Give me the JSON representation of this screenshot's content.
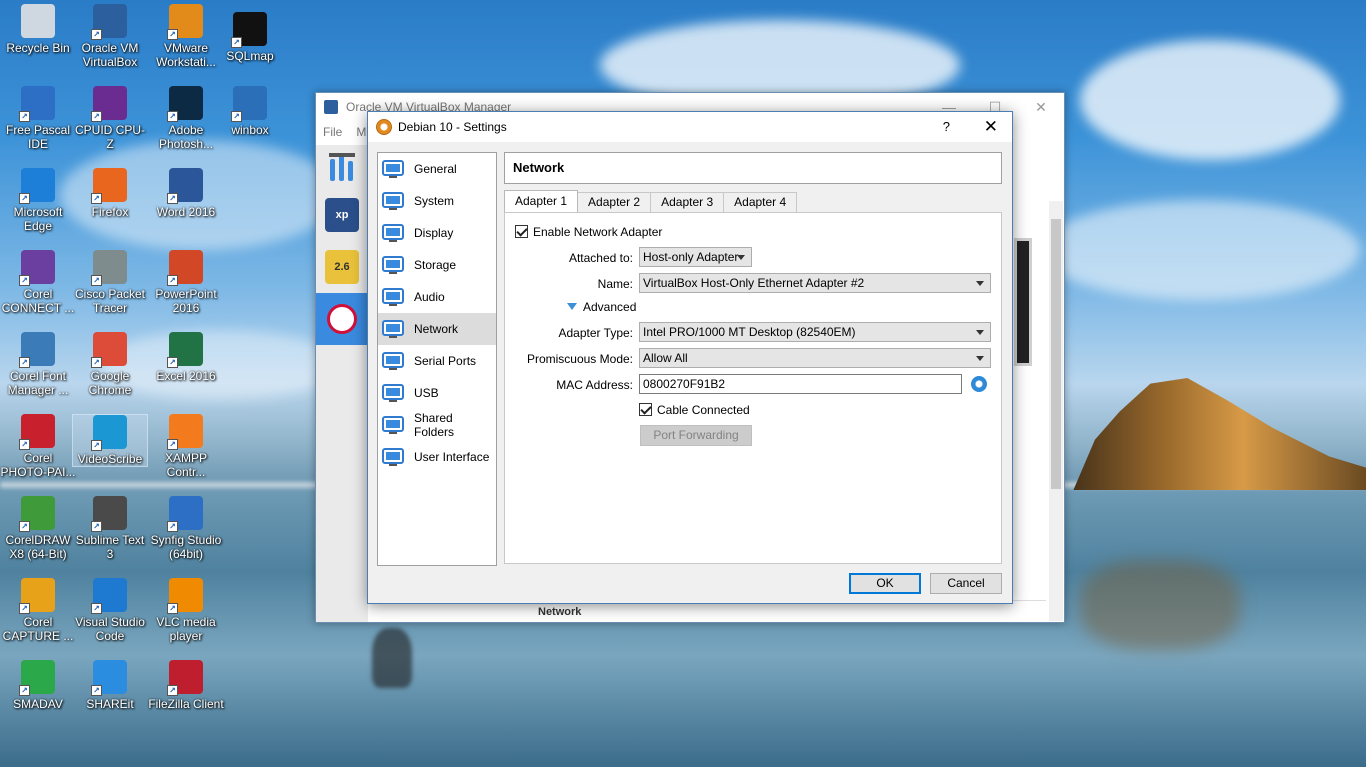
{
  "colors": {
    "accent": "#0078d7",
    "selection": "#3a8be0",
    "dialog_bg": "#f0f0f0"
  },
  "desktop_icons": [
    {
      "label": "Recycle Bin",
      "icon": "recycle-bin-icon",
      "color": "#cfd8e0"
    },
    {
      "label": "Free Pascal IDE",
      "icon": "free-pascal-icon",
      "color": "#2d6fc4"
    },
    {
      "label": "Microsoft Edge",
      "icon": "edge-icon",
      "color": "#1e7fd8"
    },
    {
      "label": "Corel CONNECT ...",
      "icon": "corel-connect-icon",
      "color": "#6b3fa0"
    },
    {
      "label": "Corel Font Manager ...",
      "icon": "corel-font-icon",
      "color": "#3b7bb8"
    },
    {
      "label": "Corel PHOTO-PAI...",
      "icon": "corel-photo-icon",
      "color": "#c8202d"
    },
    {
      "label": "CorelDRAW X8 (64-Bit)",
      "icon": "coreldraw-icon",
      "color": "#3f9a3a"
    },
    {
      "label": "Corel CAPTURE ...",
      "icon": "corel-capture-icon",
      "color": "#e8a21a"
    },
    {
      "label": "SMADAV",
      "icon": "smadav-icon",
      "color": "#2aa84a"
    },
    {
      "label": "Oracle VM VirtualBox",
      "icon": "virtualbox-icon",
      "color": "#2b5f9e"
    },
    {
      "label": "CPUID CPU-Z",
      "icon": "cpuz-icon",
      "color": "#6a2c91"
    },
    {
      "label": "Firefox",
      "icon": "firefox-icon",
      "color": "#e8661e"
    },
    {
      "label": "Cisco Packet Tracer",
      "icon": "packet-tracer-icon",
      "color": "#7f8c8d"
    },
    {
      "label": "Google Chrome",
      "icon": "chrome-icon",
      "color": "#dd4b39"
    },
    {
      "label": "VideoScribe",
      "icon": "videoscribe-icon",
      "color": "#1b98d4"
    },
    {
      "label": "Sublime Text 3",
      "icon": "sublime-icon",
      "color": "#4a4a4a"
    },
    {
      "label": "Visual Studio Code",
      "icon": "vscode-icon",
      "color": "#1d7ad0"
    },
    {
      "label": "SHAREit",
      "icon": "shareit-icon",
      "color": "#2a8de0"
    },
    {
      "label": "VMware Workstati...",
      "icon": "vmware-icon",
      "color": "#e28a1a"
    },
    {
      "label": "Adobe Photosh...",
      "icon": "photoshop-icon",
      "color": "#0d2a45"
    },
    {
      "label": "Word 2016",
      "icon": "word-icon",
      "color": "#2b579a"
    },
    {
      "label": "PowerPoint 2016",
      "icon": "powerpoint-icon",
      "color": "#d24726"
    },
    {
      "label": "Excel 2016",
      "icon": "excel-icon",
      "color": "#217346"
    },
    {
      "label": "XAMPP Contr...",
      "icon": "xampp-icon",
      "color": "#f37b1d"
    },
    {
      "label": "Synfig Studio (64bit)",
      "icon": "synfig-icon",
      "color": "#2d6fc4"
    },
    {
      "label": "VLC media player",
      "icon": "vlc-icon",
      "color": "#f08a00"
    },
    {
      "label": "FileZilla Client",
      "icon": "filezilla-icon",
      "color": "#bf1e2e"
    },
    {
      "label": "SQLmap",
      "icon": "sqlmap-icon",
      "color": "#111111"
    },
    {
      "label": "winbox",
      "icon": "winbox-icon",
      "color": "#2a6fb8"
    }
  ],
  "manager": {
    "title": "Oracle VM VirtualBox Manager",
    "menu_file": "File",
    "menu_m": "M",
    "vm_badges": [
      "xp",
      "2.6",
      ""
    ],
    "bottom_text": "Network"
  },
  "dialog": {
    "title": "Debian 10 - Settings",
    "help": "?",
    "close": "✕",
    "nav": [
      {
        "label": "General",
        "icon": "general-icon"
      },
      {
        "label": "System",
        "icon": "system-icon"
      },
      {
        "label": "Display",
        "icon": "display-icon"
      },
      {
        "label": "Storage",
        "icon": "storage-icon"
      },
      {
        "label": "Audio",
        "icon": "audio-icon"
      },
      {
        "label": "Network",
        "icon": "network-icon"
      },
      {
        "label": "Serial Ports",
        "icon": "serial-ports-icon"
      },
      {
        "label": "USB",
        "icon": "usb-icon"
      },
      {
        "label": "Shared Folders",
        "icon": "shared-folders-icon"
      },
      {
        "label": "User Interface",
        "icon": "user-interface-icon"
      }
    ],
    "active_nav": "Network",
    "page_title": "Network",
    "tabs": [
      "Adapter 1",
      "Adapter 2",
      "Adapter 3",
      "Adapter 4"
    ],
    "enable_adapter": "Enable Network Adapter",
    "attached_label": "Attached to:",
    "attached_value": "Host-only Adapter",
    "name_label": "Name:",
    "name_value": "VirtualBox Host-Only Ethernet Adapter #2",
    "advanced": "Advanced",
    "adapter_type_label": "Adapter Type:",
    "adapter_type_value": "Intel PRO/1000 MT Desktop (82540EM)",
    "promisc_label": "Promiscuous Mode:",
    "promisc_value": "Allow All",
    "mac_label": "MAC Address:",
    "mac_value": "0800270F91B2",
    "cable_connected": "Cable Connected",
    "port_forwarding": "Port Forwarding",
    "ok": "OK",
    "cancel": "Cancel"
  }
}
